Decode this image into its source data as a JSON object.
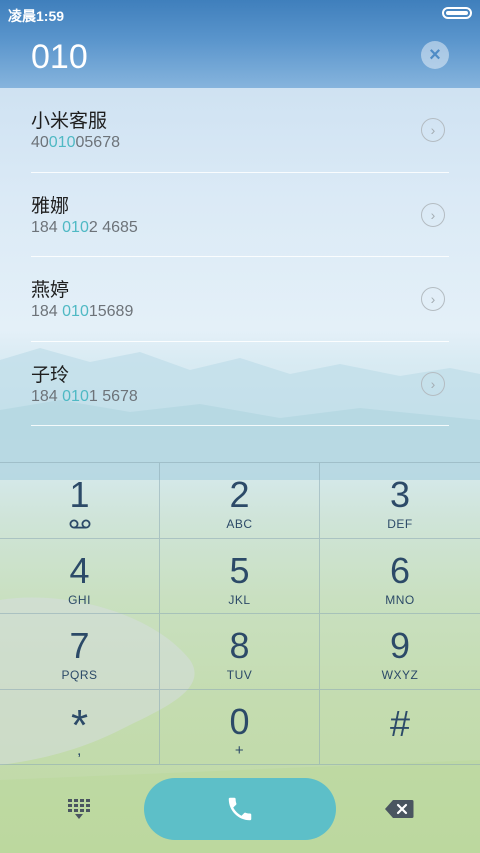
{
  "status_bar": {
    "time": "凌晨1:59"
  },
  "display": {
    "number": "010",
    "clear_icon": "close-icon"
  },
  "contacts": [
    {
      "name": "小米客服",
      "phone_pre": "40",
      "phone_match": "010",
      "phone_post": "05678"
    },
    {
      "name": "雅娜",
      "phone_pre": "184 ",
      "phone_match": "010",
      "phone_post": "2 4685"
    },
    {
      "name": "燕婷",
      "phone_pre": "184 ",
      "phone_match": "010",
      "phone_post": "15689"
    },
    {
      "name": "子玲",
      "phone_pre": "184 ",
      "phone_match": "010",
      "phone_post": "1 5678"
    }
  ],
  "keypad": [
    {
      "digit": "1",
      "letters": "",
      "icon": "voicemail-icon"
    },
    {
      "digit": "2",
      "letters": "ABC"
    },
    {
      "digit": "3",
      "letters": "DEF"
    },
    {
      "digit": "4",
      "letters": "GHI"
    },
    {
      "digit": "5",
      "letters": "JKL"
    },
    {
      "digit": "6",
      "letters": "MNO"
    },
    {
      "digit": "7",
      "letters": "PQRS"
    },
    {
      "digit": "8",
      "letters": "TUV"
    },
    {
      "digit": "9",
      "letters": "WXYZ"
    },
    {
      "digit": "*",
      "letters": ","
    },
    {
      "digit": "0",
      "letters": "+"
    },
    {
      "digit": "#",
      "letters": ""
    }
  ],
  "bottom_bar": {
    "dialpad_icon": "dialpad-grid-icon",
    "call_icon": "phone-icon",
    "backspace_icon": "backspace-icon"
  },
  "colors": {
    "accent": "#5dbfc8",
    "highlight": "#4fb9c4",
    "key_text": "#2c4a68"
  }
}
